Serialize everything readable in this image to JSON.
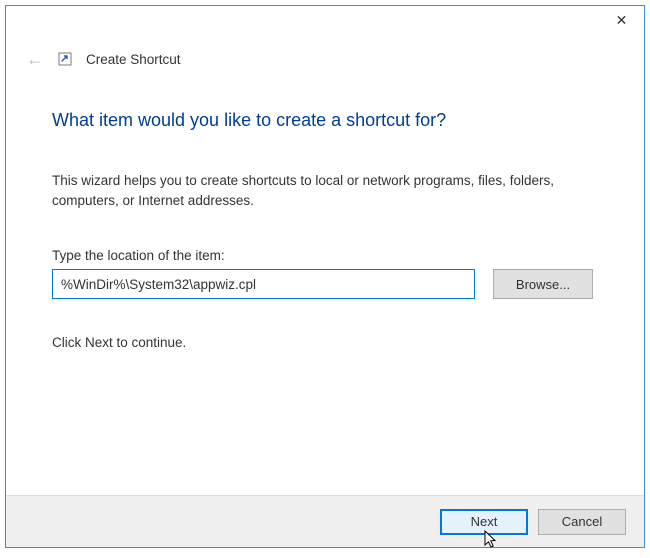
{
  "header": {
    "title": "Create Shortcut"
  },
  "content": {
    "heading": "What item would you like to create a shortcut for?",
    "description": "This wizard helps you to create shortcuts to local or network programs, files, folders, computers, or Internet addresses.",
    "input_label": "Type the location of the item:",
    "input_value": "%WinDir%\\System32\\appwiz.cpl",
    "browse_label": "Browse...",
    "continue_text": "Click Next to continue."
  },
  "footer": {
    "next_label": "Next",
    "cancel_label": "Cancel"
  }
}
